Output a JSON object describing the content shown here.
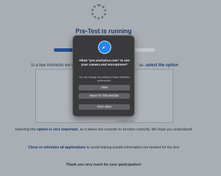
{
  "page": {
    "title": "Pre-Test is running",
    "intro_left": "In a few moments we w",
    "intro_right_plain": "se, ",
    "intro_right_bold": "select the option",
    "paragraph1_bold": "option is very important",
    "paragraph1_before": "Selecting this ",
    "paragraph1_after": ", as it allows the recorder to function correctly. We hope you understand!",
    "paragraph2_bold": "Close or minimize all applications",
    "paragraph2_after": " to avoid leaking private information not needed for the test",
    "paragraph3": "Thank you very much for your participation!",
    "faded_text": "e hope you"
  },
  "dialog": {
    "title": "Allow \"pre.userlytics.com\" to use your camera and microphone?",
    "note": "You can change this setting in Safari Websites preferences.",
    "buttons": {
      "allow": "Allow",
      "never": "Never for This Website",
      "deny": "Don't Allow"
    }
  },
  "colors": {
    "dim_overlay": "#a9aeb4",
    "dialog_bg": "#3a3a3c",
    "button_bg": "#636366",
    "title_blue": "#1d3a66",
    "safari_blue": "#1e88f2"
  },
  "icons": {
    "app": "safari-compass-icon",
    "loading": "loading-spinner-icon"
  }
}
